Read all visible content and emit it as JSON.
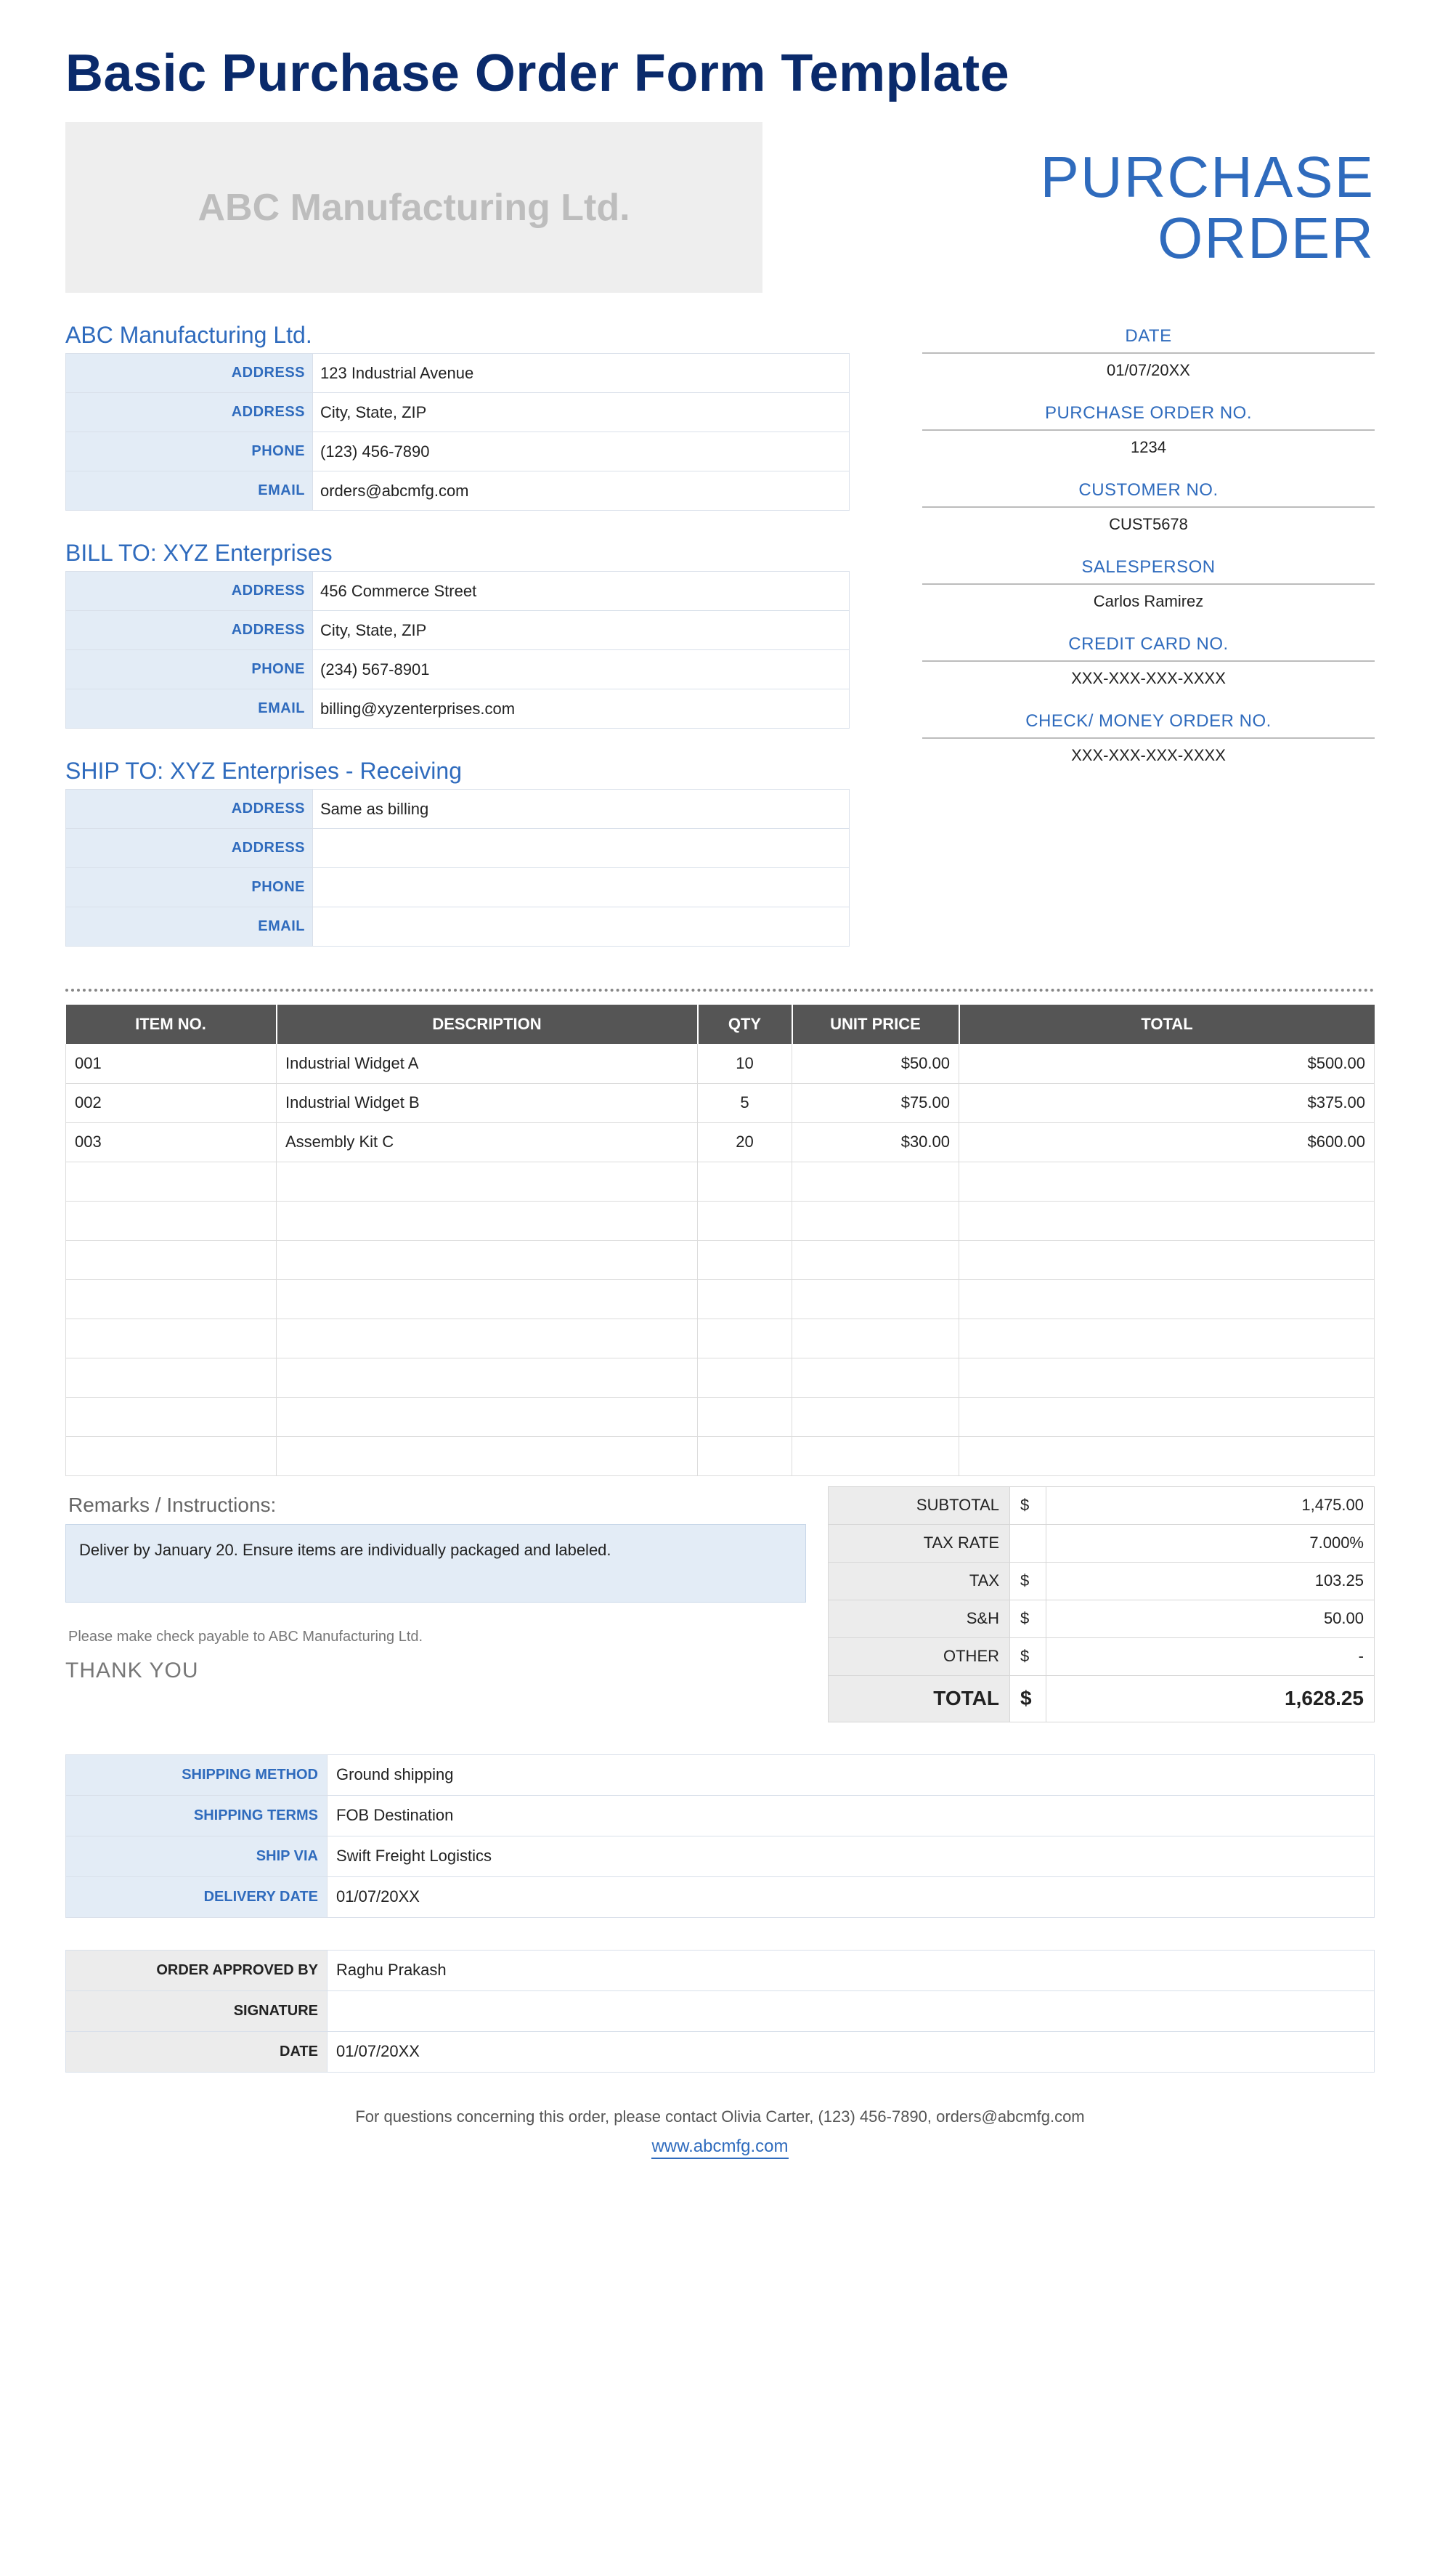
{
  "page_title": "Basic Purchase Order Form Template",
  "logo_text": "ABC Manufacturing Ltd.",
  "po_title": {
    "line1": "PURCHASE",
    "line2": "ORDER"
  },
  "company": {
    "heading": "ABC Manufacturing Ltd.",
    "rows": [
      {
        "label": "ADDRESS",
        "value": "123 Industrial Avenue"
      },
      {
        "label": "ADDRESS",
        "value": "City, State, ZIP"
      },
      {
        "label": "PHONE",
        "value": "(123) 456-7890"
      },
      {
        "label": "EMAIL",
        "value": "orders@abcmfg.com"
      }
    ]
  },
  "bill_to": {
    "heading": "BILL TO: XYZ Enterprises",
    "rows": [
      {
        "label": "ADDRESS",
        "value": "456 Commerce Street"
      },
      {
        "label": "ADDRESS",
        "value": "City, State, ZIP"
      },
      {
        "label": "PHONE",
        "value": "(234) 567-8901"
      },
      {
        "label": "EMAIL",
        "value": "billing@xyzenterprises.com"
      }
    ]
  },
  "ship_to": {
    "heading": "SHIP TO: XYZ Enterprises - Receiving",
    "rows": [
      {
        "label": "ADDRESS",
        "value": "Same as billing"
      },
      {
        "label": "ADDRESS",
        "value": ""
      },
      {
        "label": "PHONE",
        "value": ""
      },
      {
        "label": "EMAIL",
        "value": ""
      }
    ]
  },
  "meta": [
    {
      "label": "DATE",
      "value": "01/07/20XX"
    },
    {
      "label": "PURCHASE ORDER NO.",
      "value": "1234"
    },
    {
      "label": "CUSTOMER NO.",
      "value": "CUST5678"
    },
    {
      "label": "SALESPERSON",
      "value": "Carlos Ramirez"
    },
    {
      "label": "CREDIT CARD NO.",
      "value": "XXX-XXX-XXX-XXXX"
    },
    {
      "label": "CHECK/ MONEY ORDER NO.",
      "value": "XXX-XXX-XXX-XXXX"
    }
  ],
  "items_header": {
    "item_no": "ITEM NO.",
    "description": "DESCRIPTION",
    "qty": "QTY",
    "unit_price": "UNIT PRICE",
    "total": "TOTAL"
  },
  "items": [
    {
      "item_no": "001",
      "description": "Industrial Widget A",
      "qty": "10",
      "unit_price": "$50.00",
      "total": "$500.00"
    },
    {
      "item_no": "002",
      "description": "Industrial Widget B",
      "qty": "5",
      "unit_price": "$75.00",
      "total": "$375.00"
    },
    {
      "item_no": "003",
      "description": "Assembly Kit C",
      "qty": "20",
      "unit_price": "$30.00",
      "total": "$600.00"
    }
  ],
  "blank_item_rows": 8,
  "remarks": {
    "title": "Remarks / Instructions:",
    "body": "Deliver by January 20. Ensure items are individually packaged and labeled."
  },
  "payable_note": "Please make check payable to ABC Manufacturing Ltd.",
  "thank_you": "THANK YOU",
  "totals": [
    {
      "label": "SUBTOTAL",
      "currency": "$",
      "value": "1,475.00"
    },
    {
      "label": "TAX RATE",
      "currency": "",
      "value": "7.000%"
    },
    {
      "label": "TAX",
      "currency": "$",
      "value": "103.25"
    },
    {
      "label": "S&H",
      "currency": "$",
      "value": "50.00"
    },
    {
      "label": "OTHER",
      "currency": "$",
      "value": "-"
    }
  ],
  "grand_total": {
    "label": "TOTAL",
    "currency": "$",
    "value": "1,628.25"
  },
  "shipping": [
    {
      "label": "SHIPPING METHOD",
      "value": "Ground shipping"
    },
    {
      "label": "SHIPPING TERMS",
      "value": "FOB Destination"
    },
    {
      "label": "SHIP VIA",
      "value": "Swift Freight Logistics"
    },
    {
      "label": "DELIVERY DATE",
      "value": "01/07/20XX"
    }
  ],
  "approval": [
    {
      "label": "ORDER APPROVED BY",
      "value": "Raghu Prakash"
    },
    {
      "label": "SIGNATURE",
      "value": ""
    },
    {
      "label": "DATE",
      "value": "01/07/20XX"
    }
  ],
  "footer": {
    "contact_line": "For questions concerning this order, please contact Olivia Carter, (123) 456-7890, orders@abcmfg.com",
    "link_text": "www.abcmfg.com"
  }
}
